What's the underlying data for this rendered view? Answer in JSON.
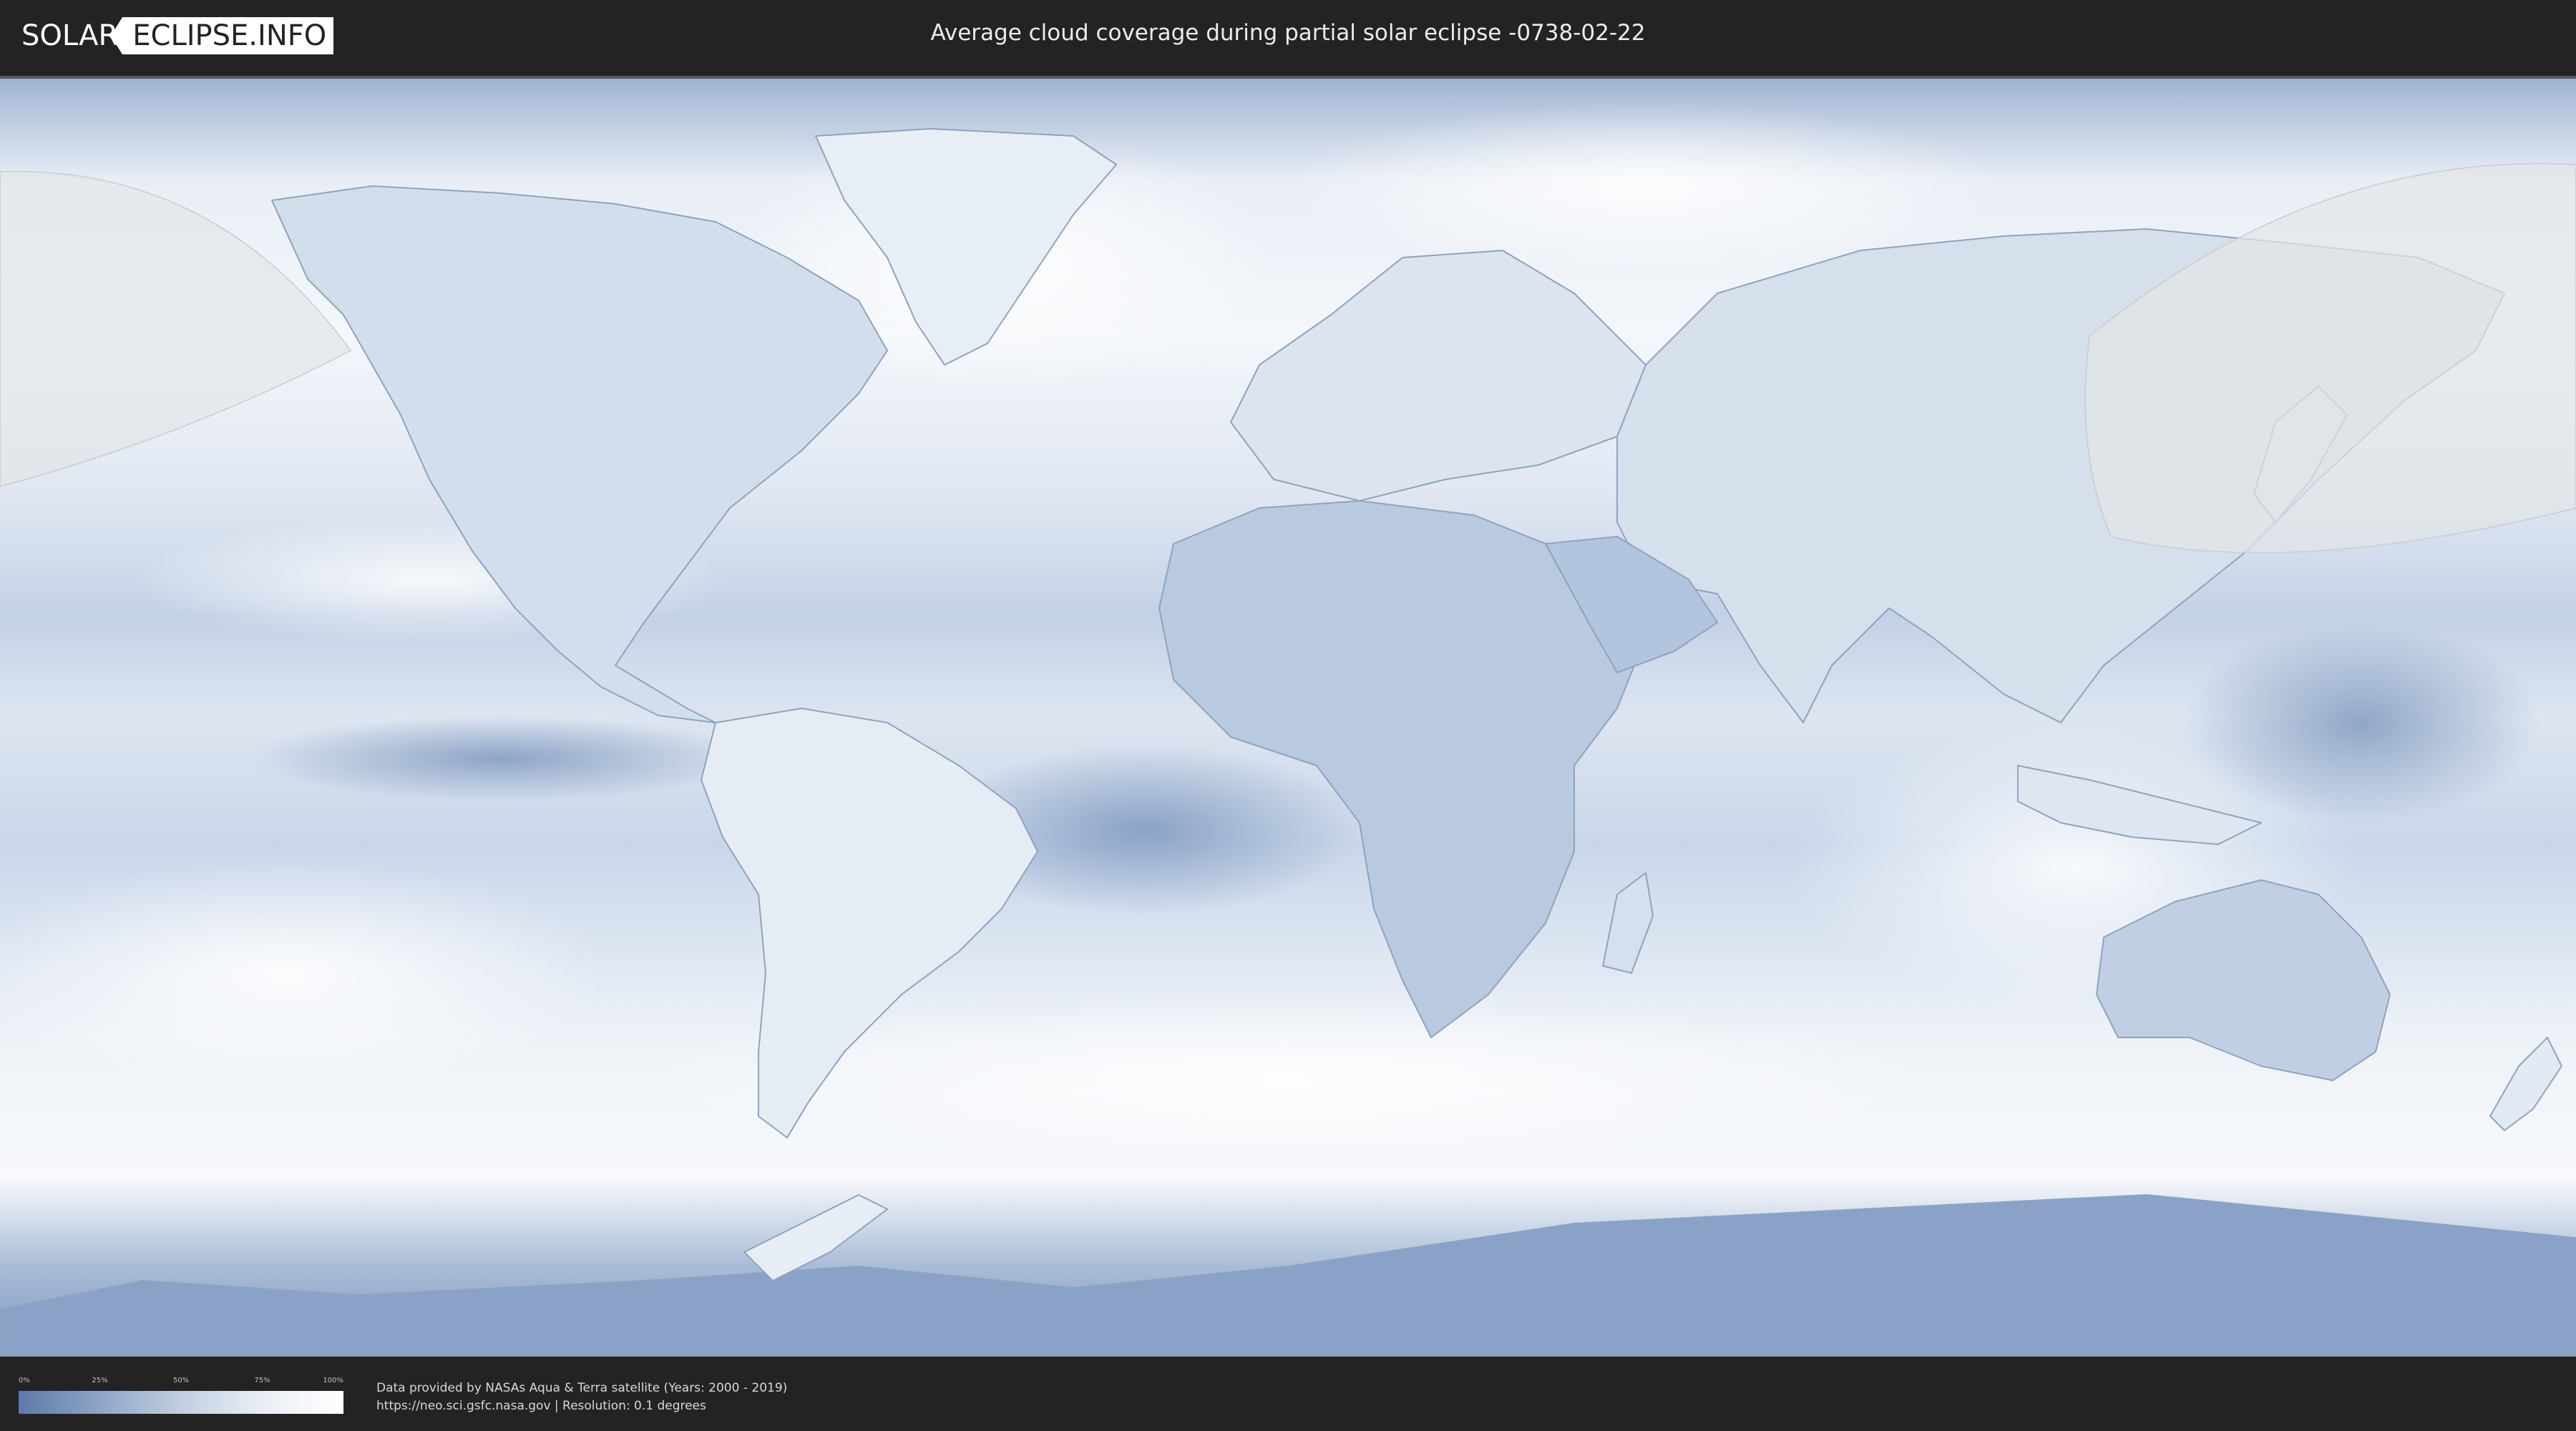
{
  "header": {
    "logo_left": "SOLAR",
    "logo_right": "ECLIPSE.INFO",
    "title": "Average cloud coverage during partial solar eclipse -0738-02-22"
  },
  "map": {
    "ocean_color": "#c9d7ea",
    "land_outline_color": "#8fa3bd",
    "clear_sky_color": "#6f8bb5",
    "cloudy_color": "#ffffff",
    "eclipse_zone_color": "#e3e5e8",
    "features": [
      "coastline",
      "country-borders",
      "eclipse-visibility-zone-west",
      "eclipse-visibility-zone-east"
    ]
  },
  "legend": {
    "ticks": [
      "0%",
      "25%",
      "50%",
      "75%",
      "100%"
    ],
    "tick_values": [
      0,
      25,
      50,
      75,
      100
    ],
    "gradient": [
      "#5e7aa8",
      "#ffffff"
    ]
  },
  "footer": {
    "credit_line_1": "Data provided by NASAs Aqua & Terra satellite (Years: 2000 - 2019)",
    "credit_line_2": "https://neo.sci.gsfc.nasa.gov | Resolution: 0.1 degrees"
  }
}
